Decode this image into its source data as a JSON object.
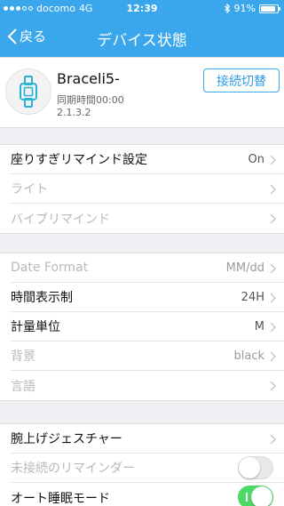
{
  "status_bar": {
    "carrier": "docomo",
    "network": "4G",
    "time": "12:39",
    "battery": "91%",
    "battery_level": 0.91
  },
  "nav": {
    "back_label": "戻る",
    "title": "デバイス状態"
  },
  "device": {
    "name": "Braceli5-",
    "sync": "同期時間00:00",
    "version": "2.1.3.2",
    "switch_label": "接続切替"
  },
  "groups": [
    {
      "rows": [
        {
          "label": "座りすぎリマインド設定",
          "value": "On"
        },
        {
          "label": "ライト",
          "value": ""
        },
        {
          "label": "バイブリマインド",
          "value": ""
        }
      ]
    },
    {
      "rows": [
        {
          "label": "Date Format",
          "value": "MM/dd"
        },
        {
          "label": "時間表示制",
          "value": "24H"
        },
        {
          "label": "計量単位",
          "value": "M"
        },
        {
          "label": "背景",
          "value": "black"
        },
        {
          "label": "言語",
          "value": ""
        }
      ]
    },
    {
      "rows": [
        {
          "label": "腕上げジェスチャー",
          "value": ""
        },
        {
          "label": "未接続のリマインダー",
          "toggle": false
        },
        {
          "label": "オート睡眠モード",
          "toggle": true
        }
      ]
    }
  ],
  "colors": {
    "nav_bar": "#3aa6ec",
    "toggle_on": "#4cd964",
    "background": "#efeff4"
  }
}
